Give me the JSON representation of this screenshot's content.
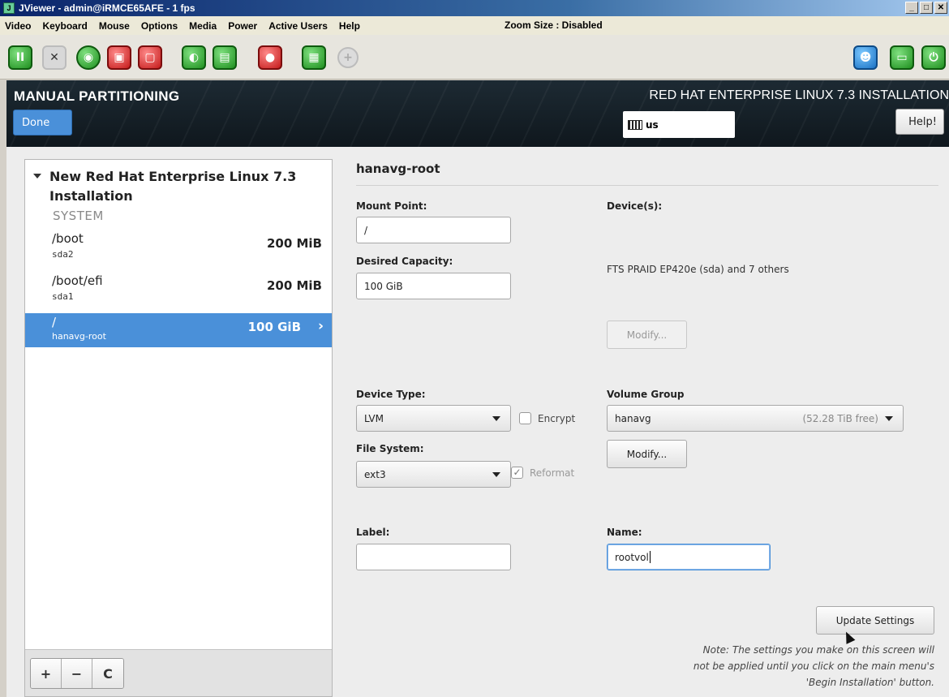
{
  "window": {
    "title": "JViewer - admin@iRMCE65AFE - 1 fps",
    "controls": [
      "_",
      "□",
      "✕"
    ]
  },
  "menu": {
    "items": [
      "Video",
      "Keyboard",
      "Mouse",
      "Options",
      "Media",
      "Power",
      "Active Users",
      "Help"
    ],
    "zoom": "Zoom Size : Disabled"
  },
  "toolbar": {
    "icons": [
      "pause-icon",
      "fullscreen-icon",
      "cd-icon",
      "floppy-icon",
      "usb-icon",
      "mouse-icon",
      "keyboard-icon",
      "video-record-icon",
      "hotkey-icon",
      "zoom-icon",
      "users-icon",
      "monitor-icon",
      "power-icon"
    ]
  },
  "header": {
    "title": "MANUAL PARTITIONING",
    "done": "Done",
    "product": "RED HAT ENTERPRISE LINUX 7.3 INSTALLATION",
    "keyboard": "us",
    "help": "Help!"
  },
  "left": {
    "install_title": "New Red Hat Enterprise Linux 7.3 Installation",
    "system_label": "SYSTEM",
    "mounts": [
      {
        "mount": "/boot",
        "device": "sda2",
        "size": "200 MiB"
      },
      {
        "mount": "/boot/efi",
        "device": "sda1",
        "size": "200 MiB"
      },
      {
        "mount": "/",
        "device": "hanavg-root",
        "size": "100 GiB"
      }
    ],
    "buttons": {
      "add": "+",
      "remove": "−",
      "refresh": "C"
    }
  },
  "detail": {
    "title": "hanavg-root",
    "mount_point_label": "Mount Point:",
    "mount_point": "/",
    "capacity_label": "Desired Capacity:",
    "capacity": "100 GiB",
    "devices_label": "Device(s):",
    "devices": "FTS PRAID EP420e (sda) and 7 others",
    "modify": "Modify...",
    "device_type_label": "Device Type:",
    "device_type": "LVM",
    "encrypt": "Encrypt",
    "fs_label": "File System:",
    "fs": "ext3",
    "reformat": "Reformat",
    "vg_label": "Volume Group",
    "vg": "hanavg",
    "vg_free": "(52.28 TiB free)",
    "vg_modify": "Modify...",
    "label_label": "Label:",
    "label_value": "",
    "name_label": "Name:",
    "name_value": "rootvol",
    "update": "Update Settings",
    "note_line1": "Note:  The settings you make on this screen will",
    "note_line2": "not be applied until you click on the main menu's",
    "note_line3": "'Begin Installation' button."
  },
  "colors": {
    "accent": "#4a90d9",
    "header_bg": "#17222a"
  }
}
